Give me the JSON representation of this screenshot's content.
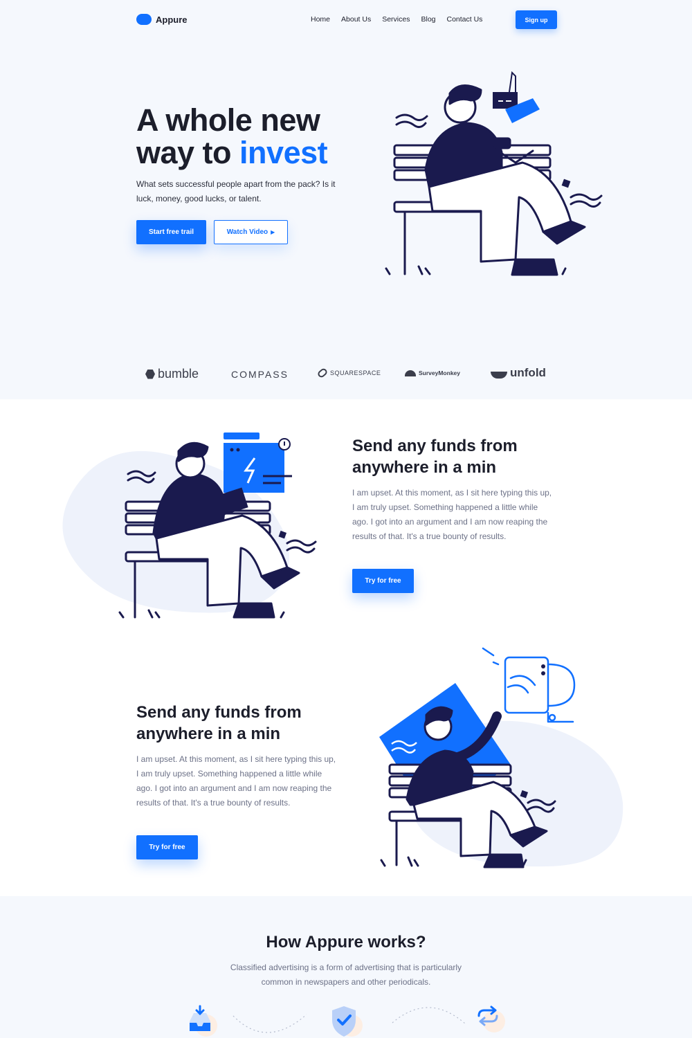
{
  "brand": {
    "name": "Appure"
  },
  "nav": {
    "items": [
      "Home",
      "About Us",
      "Services",
      "Blog",
      "Contact Us"
    ],
    "signup_label": "Sign up"
  },
  "hero": {
    "title_line1": "A whole new",
    "title_line2_prefix": "way to ",
    "title_line2_accent": "invest",
    "subtitle": "What sets successful people apart from the pack? Is it luck, money, good lucks, or talent.",
    "primary_cta": "Start free trail",
    "secondary_cta": "Watch Video"
  },
  "partners": [
    "bumble",
    "COMPASS",
    "SQUARESPACE",
    "SurveyMonkey",
    "unfold"
  ],
  "features": [
    {
      "title": "Send any funds from anywhere in a min",
      "body": "I am upset. At this moment, as I sit here typing this up, I am truly upset. Something happened a little while ago. I got into an argument and I am now reaping the results of that. It's a true bounty of results.",
      "cta": "Try for free"
    },
    {
      "title": "Send any funds from anywhere in a min",
      "body": "I am upset. At this moment, as I sit here typing this up, I am truly upset. Something happened a little while ago. I got into an argument and I am now reaping the results of that. It's a true bounty of results.",
      "cta": "Try for free"
    }
  ],
  "how": {
    "title": "How Appure works?",
    "subtitle": "Classified advertising is a form of advertising that is particularly common in newspapers and other periodicals."
  },
  "colors": {
    "accent": "#1170ff",
    "navy": "#1a1a4e",
    "text": "#1c1e2b",
    "muted": "#6c7187",
    "bg": "#f5f8fd"
  },
  "icons": [
    "download-tray-icon",
    "shield-check-icon",
    "refresh-icon"
  ]
}
